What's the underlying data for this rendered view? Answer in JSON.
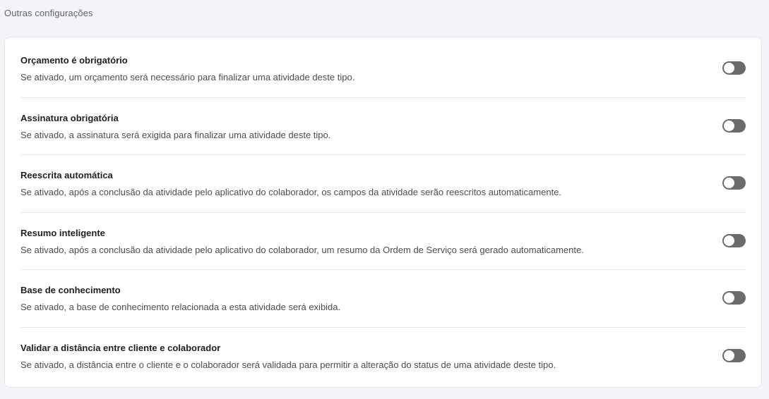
{
  "section": {
    "title": "Outras configurações"
  },
  "settings": [
    {
      "title": "Orçamento é obrigatório",
      "description": "Se ativado, um orçamento será necessário para finalizar uma atividade deste tipo.",
      "enabled": false
    },
    {
      "title": "Assinatura obrigatória",
      "description": "Se ativado, a assinatura será exigida para finalizar uma atividade deste tipo.",
      "enabled": false
    },
    {
      "title": "Reescrita automática",
      "description": "Se ativado, após a conclusão da atividade pelo aplicativo do colaborador, os campos da atividade serão reescritos automaticamente.",
      "enabled": false
    },
    {
      "title": "Resumo inteligente",
      "description": "Se ativado, após a conclusão da atividade pelo aplicativo do colaborador, um resumo da Ordem de Serviço será gerado automaticamente.",
      "enabled": false
    },
    {
      "title": "Base de conhecimento",
      "description": "Se ativado, a base de conhecimento relacionada a esta atividade será exibida.",
      "enabled": false
    },
    {
      "title": "Validar a distância entre cliente e colaborador",
      "description": "Se ativado, a distância entre o cliente e o colaborador será validada para permitir a alteração do status de uma atividade deste tipo.",
      "enabled": false
    }
  ],
  "colors": {
    "toggle_off": "#6b6b6b",
    "toggle_knob": "#ffffff",
    "card_background": "#ffffff",
    "page_background": "#f3f4f7"
  }
}
